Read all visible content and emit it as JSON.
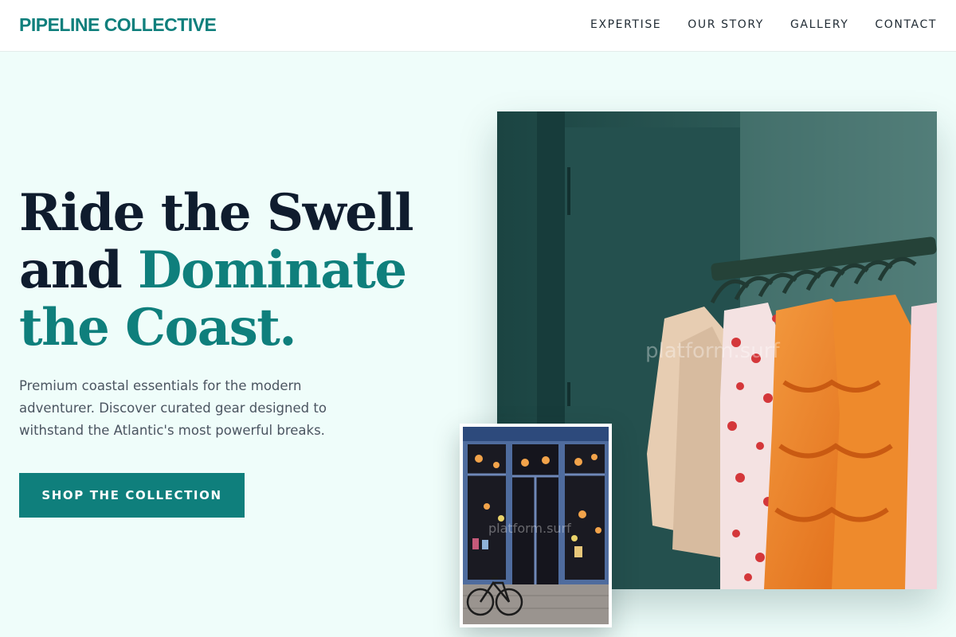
{
  "brand": {
    "name": "PIPELINE COLLECTIVE",
    "color": "#0f7f7c"
  },
  "nav": {
    "items": [
      {
        "label": "EXPERTISE"
      },
      {
        "label": "OUR STORY"
      },
      {
        "label": "GALLERY"
      },
      {
        "label": "CONTACT"
      }
    ]
  },
  "hero": {
    "headline_line1": "Ride the Swell",
    "headline_line2_plain": "and ",
    "headline_line2_accent": "Dominate",
    "headline_line3_accent": "the Coast.",
    "subtitle": "Premium coastal essentials for the modern adventurer. Discover curated gear designed to withstand the Atlantic's most powerful breaks.",
    "cta_label": "SHOP THE COLLECTION"
  },
  "images": {
    "main_watermark": "platform.surf",
    "storefront_watermark": "platform.surf"
  },
  "colors": {
    "accent": "#0f7f7c",
    "headline": "#0f1c2e",
    "page_background": "#effdfa"
  }
}
